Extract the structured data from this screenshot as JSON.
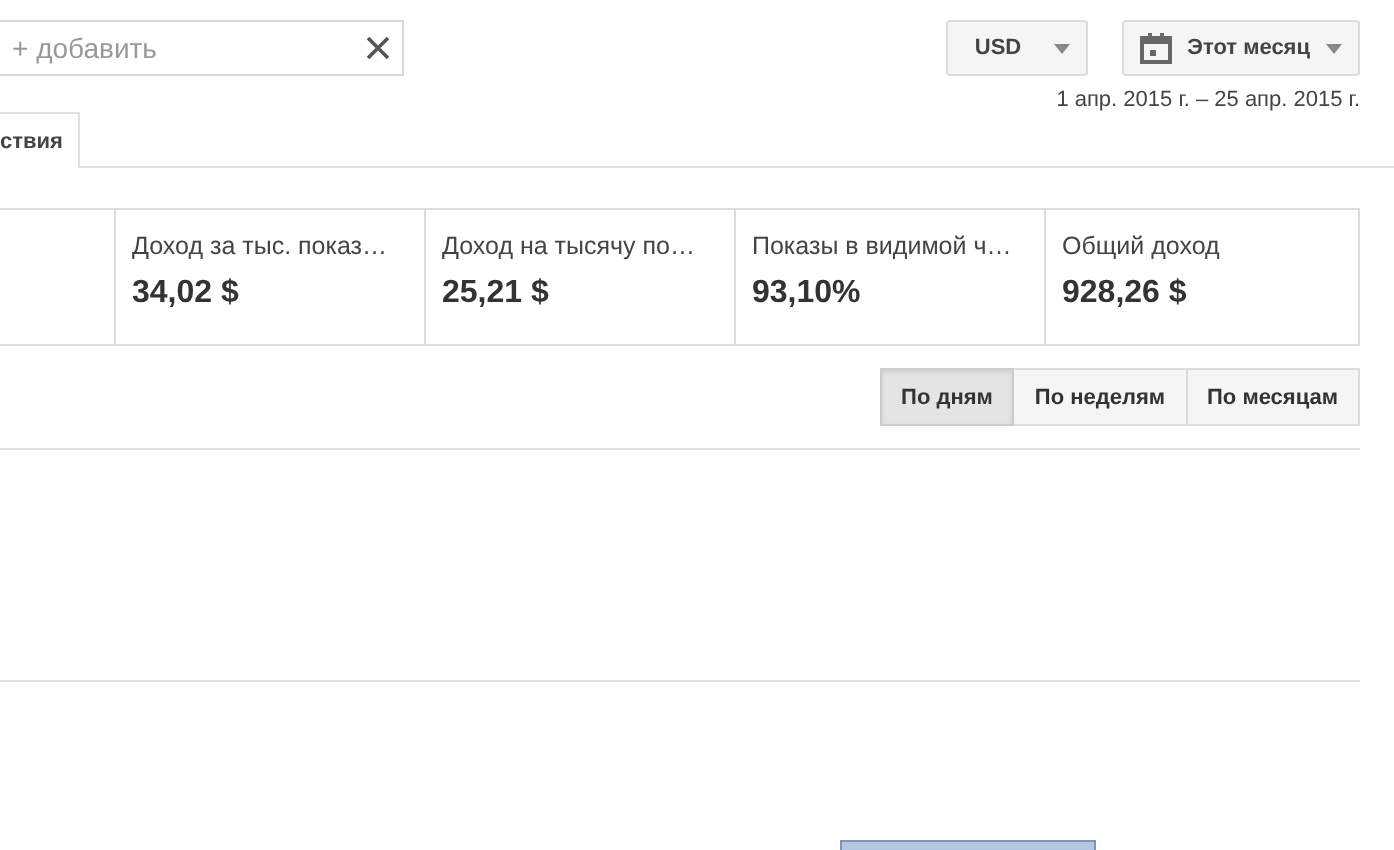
{
  "filter": {
    "placeholder": "+ добавить"
  },
  "currency": {
    "label": "USD"
  },
  "period": {
    "label": "Этот месяц",
    "range": "1 апр. 2015 г. – 25 апр. 2015 г."
  },
  "tabs": [
    {
      "label": "ствия",
      "selected": true
    }
  ],
  "metrics": [
    {
      "title": "Доход за тыс. показ…",
      "value": "34,02 $"
    },
    {
      "title": "Доход на тысячу по…",
      "value": "25,21 $"
    },
    {
      "title": "Показы в видимой ч…",
      "value": "93,10%"
    },
    {
      "title": "Общий доход",
      "value": "928,26 $"
    }
  ],
  "granularity": [
    {
      "label": "По дням",
      "selected": true
    },
    {
      "label": "По неделям",
      "selected": false
    },
    {
      "label": "По месяцам",
      "selected": false
    }
  ]
}
